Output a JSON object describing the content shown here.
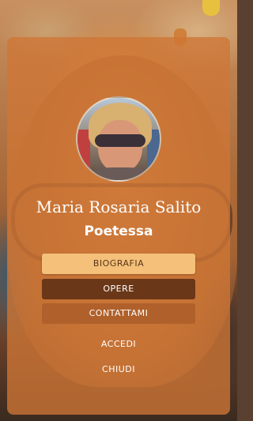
{
  "profile": {
    "name": "Maria Rosaria Salito",
    "role": "Poetessa"
  },
  "menu": {
    "biografia": "BIOGRAFIA",
    "opere": "OPERE",
    "contattami": "CONTATTAMI"
  },
  "links": {
    "accedi": "ACCEDI",
    "chiudi": "CHIUDI"
  },
  "colors": {
    "overlay": "#ce7636",
    "button_active": "#f4c07a",
    "button_dark": "#6a3718",
    "button_medium": "#b0602a"
  }
}
